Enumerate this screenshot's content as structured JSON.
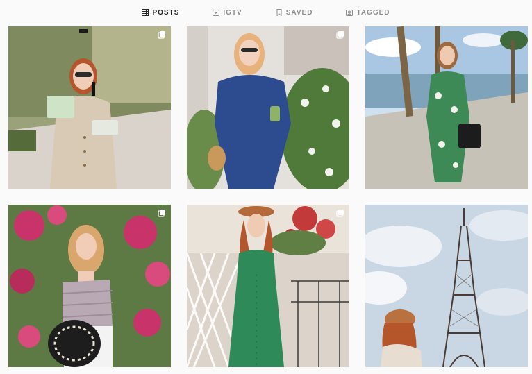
{
  "tabs": [
    {
      "label": "POSTS",
      "icon": "grid-icon",
      "active": true
    },
    {
      "label": "IGTV",
      "icon": "igtv-icon",
      "active": false
    },
    {
      "label": "SAVED",
      "icon": "bookmark-icon",
      "active": false
    },
    {
      "label": "TAGGED",
      "icon": "tag-icon",
      "active": false
    }
  ],
  "posts": [
    {
      "scene": "trench-coat-garden",
      "multiple": true
    },
    {
      "scene": "blue-dress-flowers",
      "multiple": true
    },
    {
      "scene": "floral-jumpsuit-waterfront",
      "multiple": false
    },
    {
      "scene": "lavender-top-bougainvillea",
      "multiple": true
    },
    {
      "scene": "green-dress-balcony",
      "multiple": true
    },
    {
      "scene": "eiffel-tower-beret",
      "multiple": false
    }
  ],
  "colors": {
    "background": "#fafafa",
    "tab_active": "#262626",
    "tab_inactive": "#8e8e8e"
  }
}
